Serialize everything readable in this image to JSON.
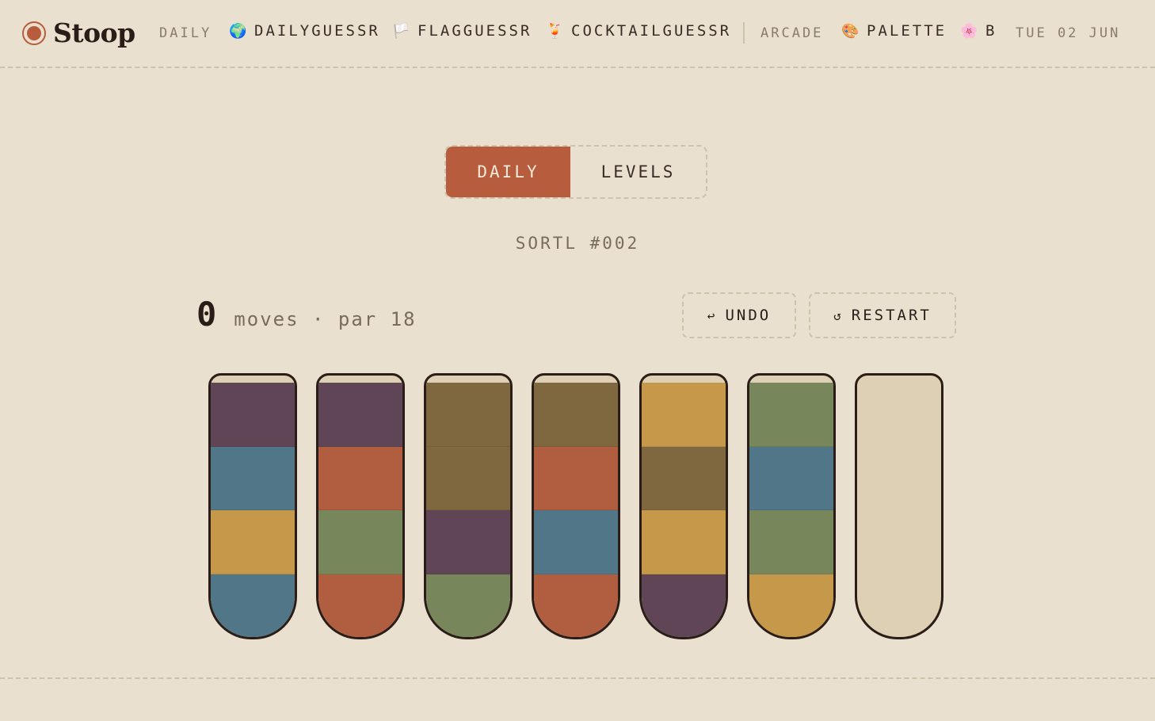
{
  "header": {
    "logo_text": "Stoop",
    "daily_label": "DAILY",
    "links": [
      {
        "emoji": "🌍",
        "label": "DAILYGUESSR",
        "icon": "globe-icon"
      },
      {
        "emoji": "🏳️",
        "label": "FLAGGUESSR",
        "icon": "flag-icon"
      },
      {
        "emoji": "🍹",
        "label": "COCKTAILGUESSR",
        "icon": "cocktail-icon"
      }
    ],
    "arcade_label": "ARCADE",
    "arcade_links": [
      {
        "emoji": "🎨",
        "label": "PALETTE",
        "icon": "palette-icon"
      },
      {
        "emoji": "🌸",
        "label": "B",
        "icon": "blossom-icon"
      }
    ],
    "date": "TUE 02 JUN"
  },
  "mode_toggle": {
    "options": [
      "DAILY",
      "LEVELS"
    ],
    "selected": "DAILY"
  },
  "puzzle": {
    "id_label": "SORTL #002"
  },
  "stats": {
    "moves": "0",
    "moves_label": "moves · par 18"
  },
  "controls": {
    "undo_icon": "↩",
    "undo_label": "UNDO",
    "restart_icon": "↺",
    "restart_label": "RESTART"
  },
  "colors": {
    "accent": "#b85c3e",
    "plum": "#5f4555",
    "teal": "#507687",
    "mustard": "#c6994a",
    "brown": "#7f673f",
    "rust": "#b05d40",
    "sage": "#77865b",
    "empty": "#ddd0b4"
  },
  "tubes": [
    [
      "plum",
      "teal",
      "mustard",
      "teal"
    ],
    [
      "plum",
      "rust",
      "sage",
      "rust"
    ],
    [
      "brown",
      "brown",
      "plum",
      "sage"
    ],
    [
      "brown",
      "rust",
      "teal",
      "rust"
    ],
    [
      "mustard",
      "brown",
      "mustard",
      "plum"
    ],
    [
      "sage",
      "teal",
      "sage",
      "mustard"
    ],
    []
  ]
}
